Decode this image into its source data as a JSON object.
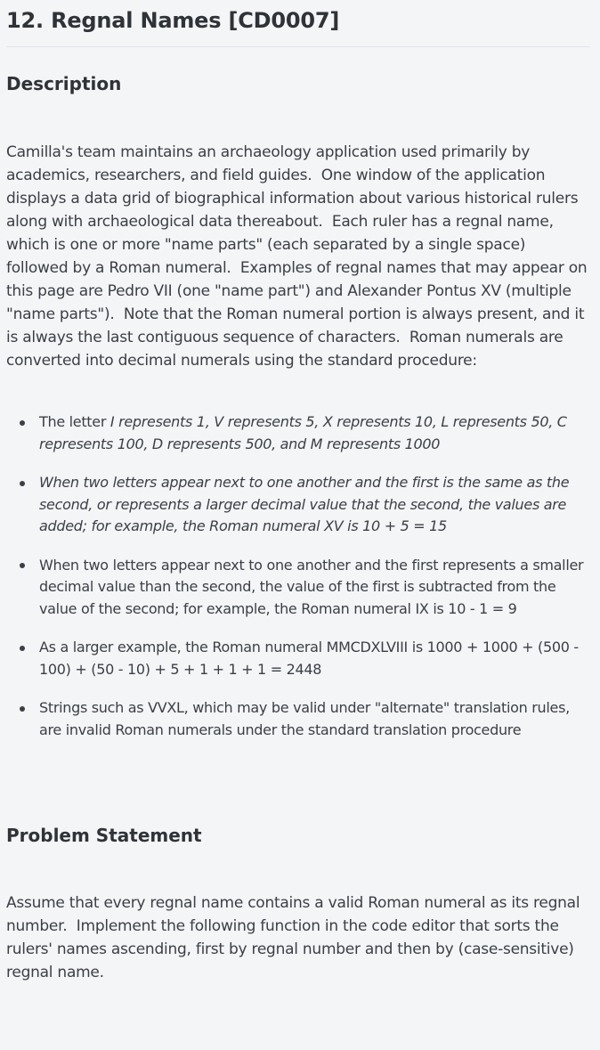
{
  "title": "12. Regnal Names [CD0007]",
  "description": {
    "heading": "Description",
    "paragraph": "Camilla's team maintains an archaeology application used primarily by academics, researchers, and field guides.  One window of the application displays a data grid of biographical information about various historical rulers along with archaeological data thereabout.  Each ruler has a regnal name, which is one or more \"name parts\" (each separated by a single space) followed by a Roman numeral.  Examples of regnal names that may appear on this page are Pedro VII (one \"name part\") and Alexander Pontus XV (multiple \"name parts\").  Note that the Roman numeral portion is always present, and it is always the last contiguous sequence of characters.  Roman numerals are converted into decimal numerals using the standard procedure:",
    "rules": [
      {
        "lead": "The letter ",
        "italic": "I represents 1, V represents 5, X represents 10, L represents 50, C represents 100, D represents 500, and M represents 1000"
      },
      {
        "italic": "When two letters appear next to one another and the first is the same as the second, or represents a larger decimal value that the second, the values are added; for example, the Roman numeral XV is 10 + 5 = 15"
      },
      {
        "text": "When two letters appear next to one another and the first represents a smaller decimal value than the second, the value of the first is subtracted from the value of the second; for example, the Roman numeral IX is 10 - 1 = 9"
      },
      {
        "text": "As a larger example, the Roman numeral MMCDXLVIII is 1000 + 1000 + (500 - 100) + (50 - 10) + 5 + 1 + 1 + 1 = 2448"
      },
      {
        "text": "Strings such as VVXL, which may be valid under \"alternate\" translation rules, are invalid Roman numerals under the standard translation procedure"
      }
    ]
  },
  "problem": {
    "heading": "Problem Statement",
    "paragraph": "Assume that every regnal name contains a valid Roman numeral as its regnal number.  Implement the following function in the code editor that sorts the rulers' names ascending, first by regnal number and then by (case-sensitive) regnal name."
  }
}
